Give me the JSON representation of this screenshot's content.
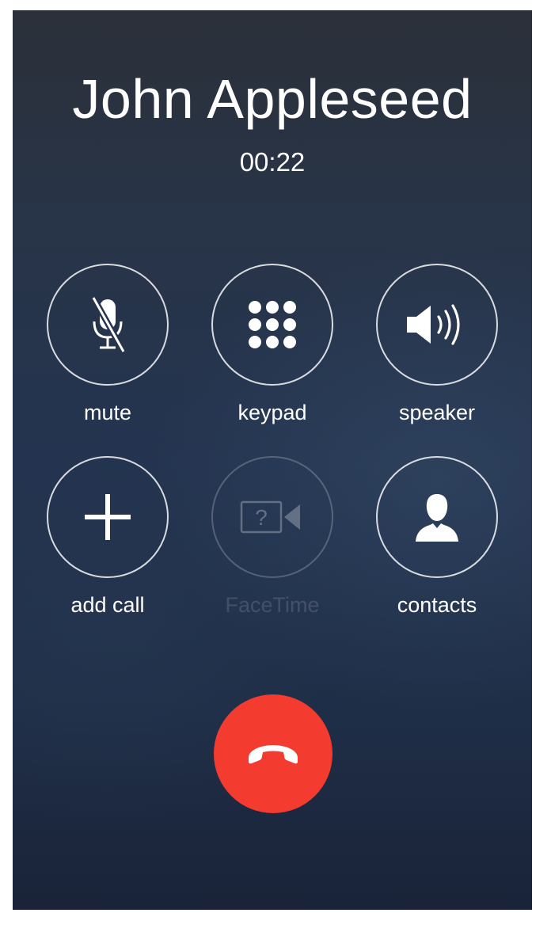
{
  "call": {
    "caller_name": "John Appleseed",
    "duration": "00:22"
  },
  "controls": [
    {
      "label": "mute",
      "icon": "microphone-muted-icon",
      "enabled": true
    },
    {
      "label": "keypad",
      "icon": "keypad-grid-icon",
      "enabled": true
    },
    {
      "label": "speaker",
      "icon": "speaker-icon",
      "enabled": true
    },
    {
      "label": "add call",
      "icon": "plus-icon",
      "enabled": true
    },
    {
      "label": "FaceTime",
      "icon": "facetime-camera-icon",
      "enabled": false
    },
    {
      "label": "contacts",
      "icon": "contact-person-icon",
      "enabled": true
    }
  ],
  "end_call": {
    "icon": "phone-hangup-icon",
    "color": "#f43b30"
  },
  "colors": {
    "text": "#ffffff",
    "end_call": "#f43b30",
    "background_top": "#2b3039",
    "background_bottom": "#1a2338"
  }
}
